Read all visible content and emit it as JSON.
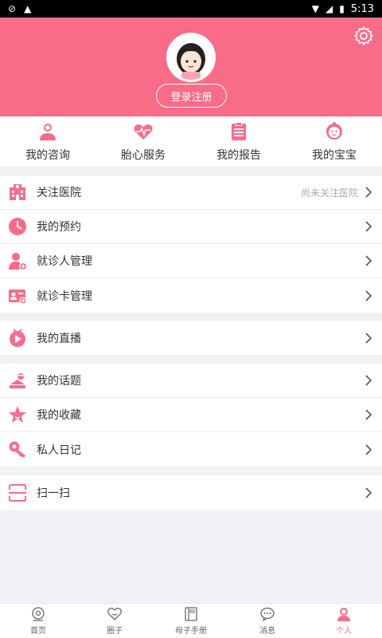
{
  "status_bar": {
    "time": "5:13"
  },
  "header": {
    "login_label": "登录注册"
  },
  "quick_actions": [
    {
      "label": "我的咨询",
      "icon": "consult-icon"
    },
    {
      "label": "胎心服务",
      "icon": "heart-pulse-icon"
    },
    {
      "label": "我的报告",
      "icon": "clipboard-icon"
    },
    {
      "label": "我的宝宝",
      "icon": "baby-face-icon"
    }
  ],
  "groups": [
    {
      "rows": [
        {
          "label": "关注医院",
          "hint": "尚未关注医院",
          "icon": "hospital-icon"
        },
        {
          "label": "我的预约",
          "hint": "",
          "icon": "clock-icon"
        },
        {
          "label": "就诊人管理",
          "hint": "",
          "icon": "patient-icon"
        },
        {
          "label": "就诊卡管理",
          "hint": "",
          "icon": "id-card-icon"
        }
      ]
    },
    {
      "rows": [
        {
          "label": "我的直播",
          "hint": "",
          "icon": "live-tv-icon"
        }
      ]
    },
    {
      "rows": [
        {
          "label": "我的话题",
          "hint": "",
          "icon": "topic-icon"
        },
        {
          "label": "我的收藏",
          "hint": "",
          "icon": "star-icon"
        },
        {
          "label": "私人日记",
          "hint": "",
          "icon": "key-icon"
        }
      ]
    },
    {
      "rows": [
        {
          "label": "扫一扫",
          "hint": "",
          "icon": "scan-icon"
        }
      ]
    }
  ],
  "tabbar": [
    {
      "label": "首页",
      "icon": "home-icon",
      "active": false
    },
    {
      "label": "圈子",
      "icon": "circle-heart-icon",
      "active": false
    },
    {
      "label": "母子手册",
      "icon": "book-icon",
      "active": false
    },
    {
      "label": "消息",
      "icon": "message-icon",
      "active": false
    },
    {
      "label": "个人",
      "icon": "person-icon",
      "active": true
    }
  ],
  "colors": {
    "accent": "#f96c88",
    "background": "#f2f2f6"
  }
}
